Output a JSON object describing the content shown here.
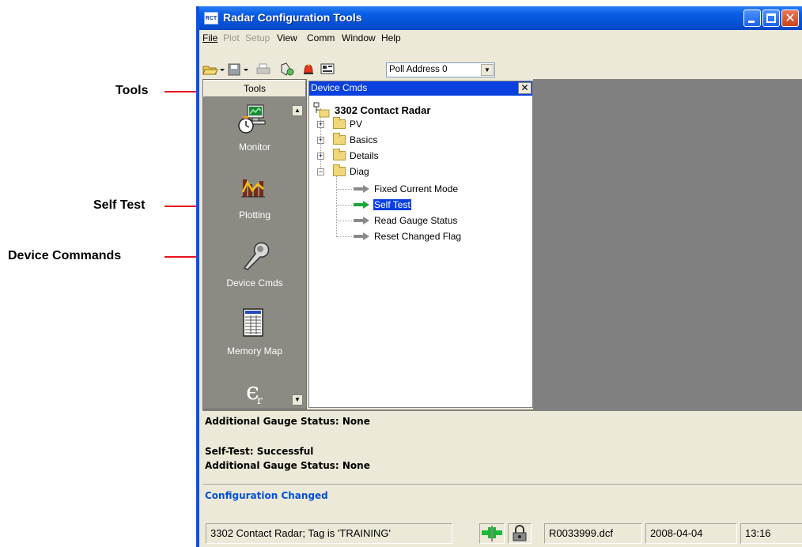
{
  "callouts": {
    "tools": "Tools",
    "self_test": "Self Test",
    "device_commands": "Device Commands"
  },
  "window": {
    "app_icon_text": "RCT",
    "title": "Radar Configuration Tools"
  },
  "menu": [
    {
      "label": "File",
      "enabled": true
    },
    {
      "label": "Plot",
      "enabled": false
    },
    {
      "label": "Setup",
      "enabled": false
    },
    {
      "label": "View",
      "enabled": true
    },
    {
      "label": "Comm",
      "enabled": true
    },
    {
      "label": "Window",
      "enabled": true
    },
    {
      "label": "Help",
      "enabled": true
    }
  ],
  "toolbar": {
    "poll_address": "Poll Address 0",
    "icons": [
      "open-folder-icon",
      "save-icon",
      "print-icon",
      "search-device-icon",
      "alarm-icon",
      "tag-icon"
    ]
  },
  "tools_panel": {
    "header": "Tools",
    "items": [
      {
        "label": "Monitor",
        "icon": "monitor-icon"
      },
      {
        "label": "Plotting",
        "icon": "plotting-icon"
      },
      {
        "label": "Device Cmds",
        "icon": "wrench-icon"
      },
      {
        "label": "Memory Map",
        "icon": "memory-map-icon"
      },
      {
        "label": "",
        "icon": "epsilon-r-icon"
      }
    ]
  },
  "device_cmds": {
    "header": "Device Cmds",
    "root": "3302 Contact Radar",
    "folders": [
      "PV",
      "Basics",
      "Details",
      "Diag"
    ],
    "diag_items": [
      "Fixed Current Mode",
      "Self Test",
      "Read Gauge Status",
      "Reset Changed Flag"
    ],
    "selected": "Self Test"
  },
  "status_log": {
    "line1": "Additional Gauge Status: None",
    "line2": "Self-Test: Successful",
    "line3": "Additional Gauge Status: None",
    "config_changed": "Configuration Changed",
    "config_color": "#0050d8"
  },
  "statusbar": {
    "device": "3302 Contact Radar;  Tag is 'TRAINING'",
    "file": "R0033999.dcf",
    "date": "2008-04-04",
    "time": "13:16"
  }
}
